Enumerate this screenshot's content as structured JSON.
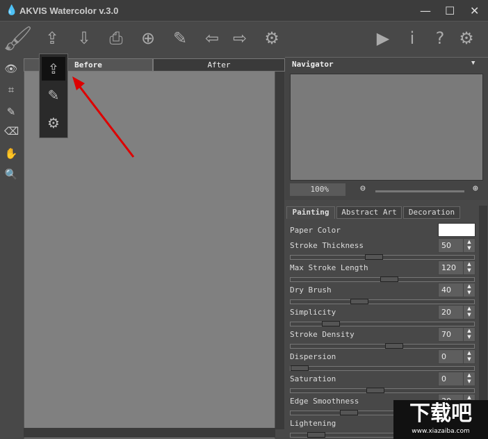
{
  "window": {
    "title": "AKVIS Watercolor v.3.0",
    "minimize": "—",
    "maximize": "☐",
    "close": "✕"
  },
  "toolbar": [
    {
      "name": "open-icon",
      "glyph": "⇪"
    },
    {
      "name": "save-icon",
      "glyph": "⇩"
    },
    {
      "name": "print-icon",
      "glyph": "⎙"
    },
    {
      "name": "share-icon",
      "glyph": "⊕"
    },
    {
      "name": "batch-icon",
      "glyph": "✎"
    },
    {
      "name": "back-icon",
      "glyph": "⇦"
    },
    {
      "name": "forward-icon",
      "glyph": "⇨"
    },
    {
      "name": "settings-icon",
      "glyph": "⚙"
    },
    {
      "name": "run-icon",
      "glyph": "▶"
    },
    {
      "name": "info-icon",
      "glyph": "i"
    },
    {
      "name": "help-icon",
      "glyph": "?"
    },
    {
      "name": "preferences-icon",
      "glyph": "⚙"
    }
  ],
  "view_tabs": {
    "before": "Before",
    "after": "After"
  },
  "navigator": {
    "title": "Navigator",
    "zoom": "100%"
  },
  "settings_tabs": [
    "Painting",
    "Abstract Art",
    "Decoration"
  ],
  "paper_color_label": "Paper Color",
  "paper_color": "#ffffff",
  "params": [
    {
      "label": "Stroke Thickness",
      "value": "50",
      "slider": 0.45
    },
    {
      "label": "Max Stroke Length",
      "value": "120",
      "slider": 0.54
    },
    {
      "label": "Dry Brush",
      "value": "40",
      "slider": 0.36
    },
    {
      "label": "Simplicity",
      "value": "20",
      "slider": 0.19
    },
    {
      "label": "Stroke Density",
      "value": "70",
      "slider": 0.57
    },
    {
      "label": "Dispersion",
      "value": "0",
      "slider": 0.0
    },
    {
      "label": "Saturation",
      "value": "0",
      "slider": 0.46
    },
    {
      "label": "Edge Smoothness",
      "value": "30",
      "slider": 0.3
    },
    {
      "label": "Lightening",
      "value": "",
      "slider": 0.1
    }
  ],
  "watermark": {
    "text": "下载吧",
    "url": "www.xiazaiba.com"
  }
}
